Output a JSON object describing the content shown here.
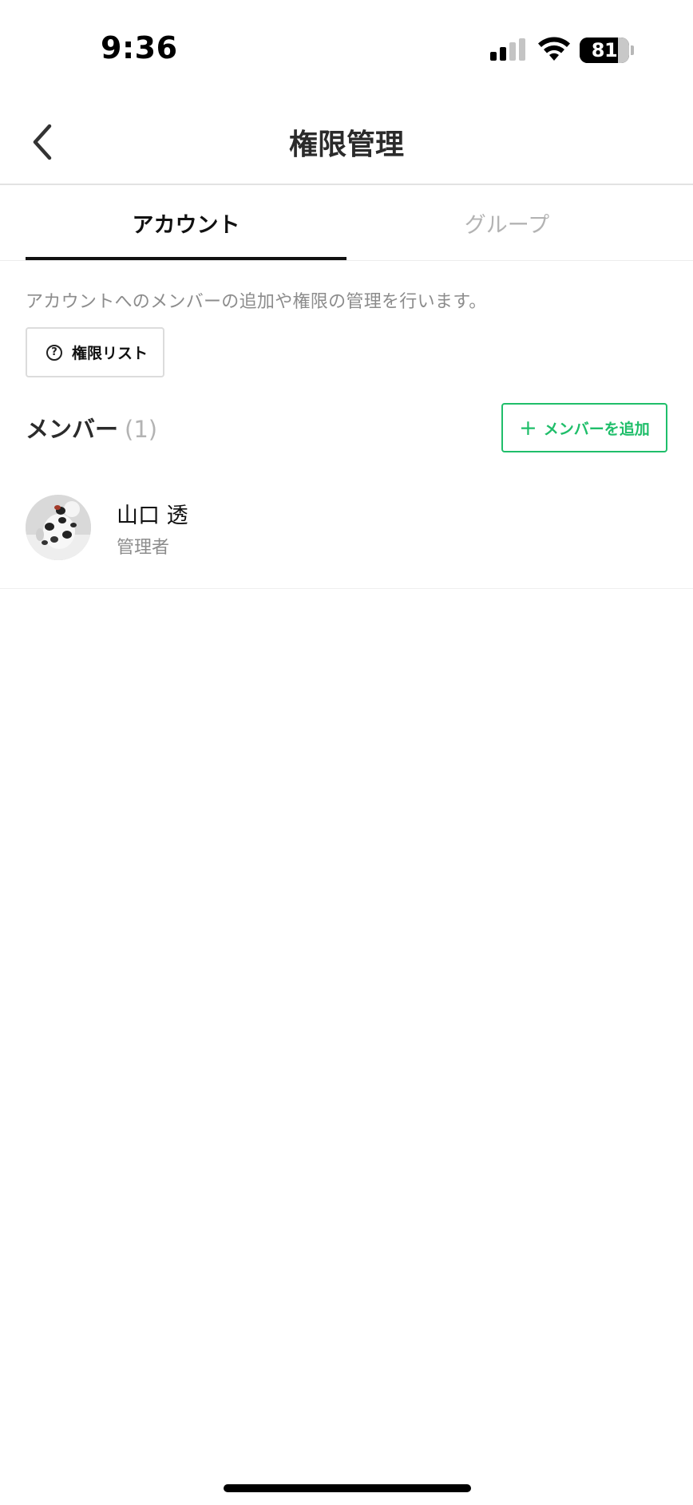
{
  "status_bar": {
    "time": "9:36",
    "battery": "81"
  },
  "header": {
    "title": "権限管理"
  },
  "tabs": [
    {
      "label": "アカウント",
      "active": true
    },
    {
      "label": "グループ",
      "active": false
    }
  ],
  "description": "アカウントへのメンバーの追加や権限の管理を行います。",
  "permission_list_button": {
    "label": "権限リスト",
    "icon": "?"
  },
  "members": {
    "title": "メンバー",
    "count": "(1)",
    "add_button_label": "メンバーを追加",
    "add_button_icon": "+",
    "items": [
      {
        "name": "山口 透",
        "role": "管理者"
      }
    ]
  },
  "colors": {
    "accent": "#1fbe6a",
    "text_primary": "#111111",
    "text_secondary": "#8c8c8c",
    "tab_inactive": "#b3b3b3"
  }
}
